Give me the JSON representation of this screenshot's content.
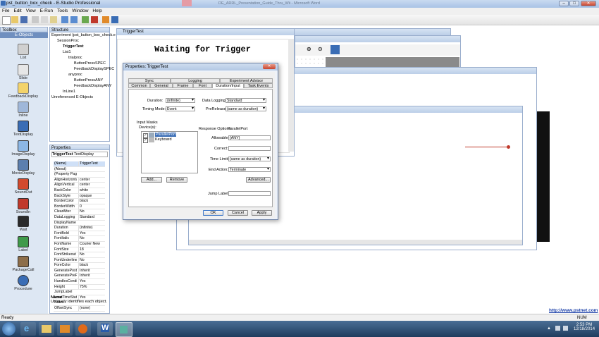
{
  "app": {
    "title": "pst_button_box_check - E-Studio Professional",
    "bg_tab_title": "DE_ARRL_Presentation_Guide_Thru_Wii - Microsoft Word"
  },
  "menu": [
    "File",
    "Edit",
    "View",
    "E-Run",
    "Tools",
    "Window",
    "Help"
  ],
  "toolbox": {
    "title": "Toolbox",
    "section": "E-Objects",
    "items": [
      "List",
      "Slide",
      "FeedbackDisplay",
      "Inline",
      "TextDisplay",
      "ImageDisplay",
      "MovieDisplay",
      "SoundOut",
      "SoundIn",
      "Wait",
      "Label",
      "PackageCall",
      "Procedure"
    ]
  },
  "structure": {
    "title": "Structure",
    "rows": [
      "Experiment (pst_button_box_check.e",
      "SessionProc",
      "TriggerTest",
      "List1",
      "trialproc",
      "ButtonPressSPEC",
      "FeedbackDisplaySPEC",
      "anyproc",
      "ButtonPressANY",
      "FeedbackDisplayANY",
      "InLine1",
      "Unreferenced E-Objects"
    ]
  },
  "properties": {
    "title": "Properties",
    "object": "TriggerTest",
    "object_type": "TextDisplay",
    "rows": [
      [
        "(Name)",
        "TriggerTest"
      ],
      [
        "(About)",
        ""
      ],
      [
        "(Property Pag",
        ""
      ],
      [
        "AlignHorizonta",
        "center"
      ],
      [
        "AlignVertical",
        "center"
      ],
      [
        "BackColor",
        "white"
      ],
      [
        "BackStyle",
        "opaque"
      ],
      [
        "BorderColor",
        "black"
      ],
      [
        "BorderWidth",
        "0"
      ],
      [
        "ClearAfter",
        "No"
      ],
      [
        "DataLogging",
        "Standard"
      ],
      [
        "DisplayName",
        ""
      ],
      [
        "Duration",
        "(infinite)"
      ],
      [
        "FontBold",
        "Yes"
      ],
      [
        "FontItalic",
        "No"
      ],
      [
        "FontName",
        "Courier New"
      ],
      [
        "FontSize",
        "18"
      ],
      [
        "FontStrikeout",
        "No"
      ],
      [
        "FontUnderline",
        "No"
      ],
      [
        "ForeColor",
        "black"
      ],
      [
        "GeneratePostI",
        "Inherit"
      ],
      [
        "GeneratePreRi",
        "Inherit"
      ],
      [
        "HandlesCondit",
        "Yes"
      ],
      [
        "Height",
        "75%"
      ],
      [
        "JumpLabel",
        ""
      ],
      [
        "LoadTimeStats",
        "Yes"
      ],
      [
        "Notes",
        ""
      ],
      [
        "OffsetSync",
        "(none)"
      ]
    ],
    "desc_title": "Name",
    "desc_text": "Uniquely identifies each object."
  },
  "trigger_window": {
    "title": "TriggerTest",
    "text": "Waiting for Trigger"
  },
  "dialog": {
    "title": "Properties: TriggerTest",
    "tabs_top": [
      "Sync",
      "Logging",
      "Experiment Advisor"
    ],
    "tabs_bottom": [
      "Common",
      "General",
      "Frame",
      "Font",
      "Duration/Input",
      "Task Events"
    ],
    "duration_label": "Duration:",
    "duration_value": "(infinite)",
    "timing_label": "Timing Mode:",
    "timing_value": "Event",
    "datalog_label": "Data Logging:",
    "datalog_value": "Standard",
    "prerelease_label": "PreRelease:",
    "prerelease_value": "(same as duration)",
    "input_masks": "Input Masks",
    "devices_label": "Device(s):",
    "devices": [
      "ParallelPort",
      "Keyboard"
    ],
    "add_button": "Add...",
    "remove_button": "Remove",
    "response_options": "Response Options:",
    "response_device": "ParallelPort",
    "allowable_label": "Allowable:",
    "allowable_value": "{ANY}",
    "correct_label": "Correct:",
    "timelimit_label": "Time Limit:",
    "timelimit_value": "(same as duration)",
    "endaction_label": "End Action:",
    "endaction_value": "Terminate",
    "advanced_button": "Advanced...",
    "jumplabel_label": "Jump Label:",
    "ok": "OK",
    "cancel": "Cancel",
    "apply": "Apply"
  },
  "status": {
    "left": "Ready",
    "right": "NUM"
  },
  "link": "http://www.pstnet.com",
  "clock": {
    "time": "2:53 PM",
    "date": "12/18/2014"
  }
}
